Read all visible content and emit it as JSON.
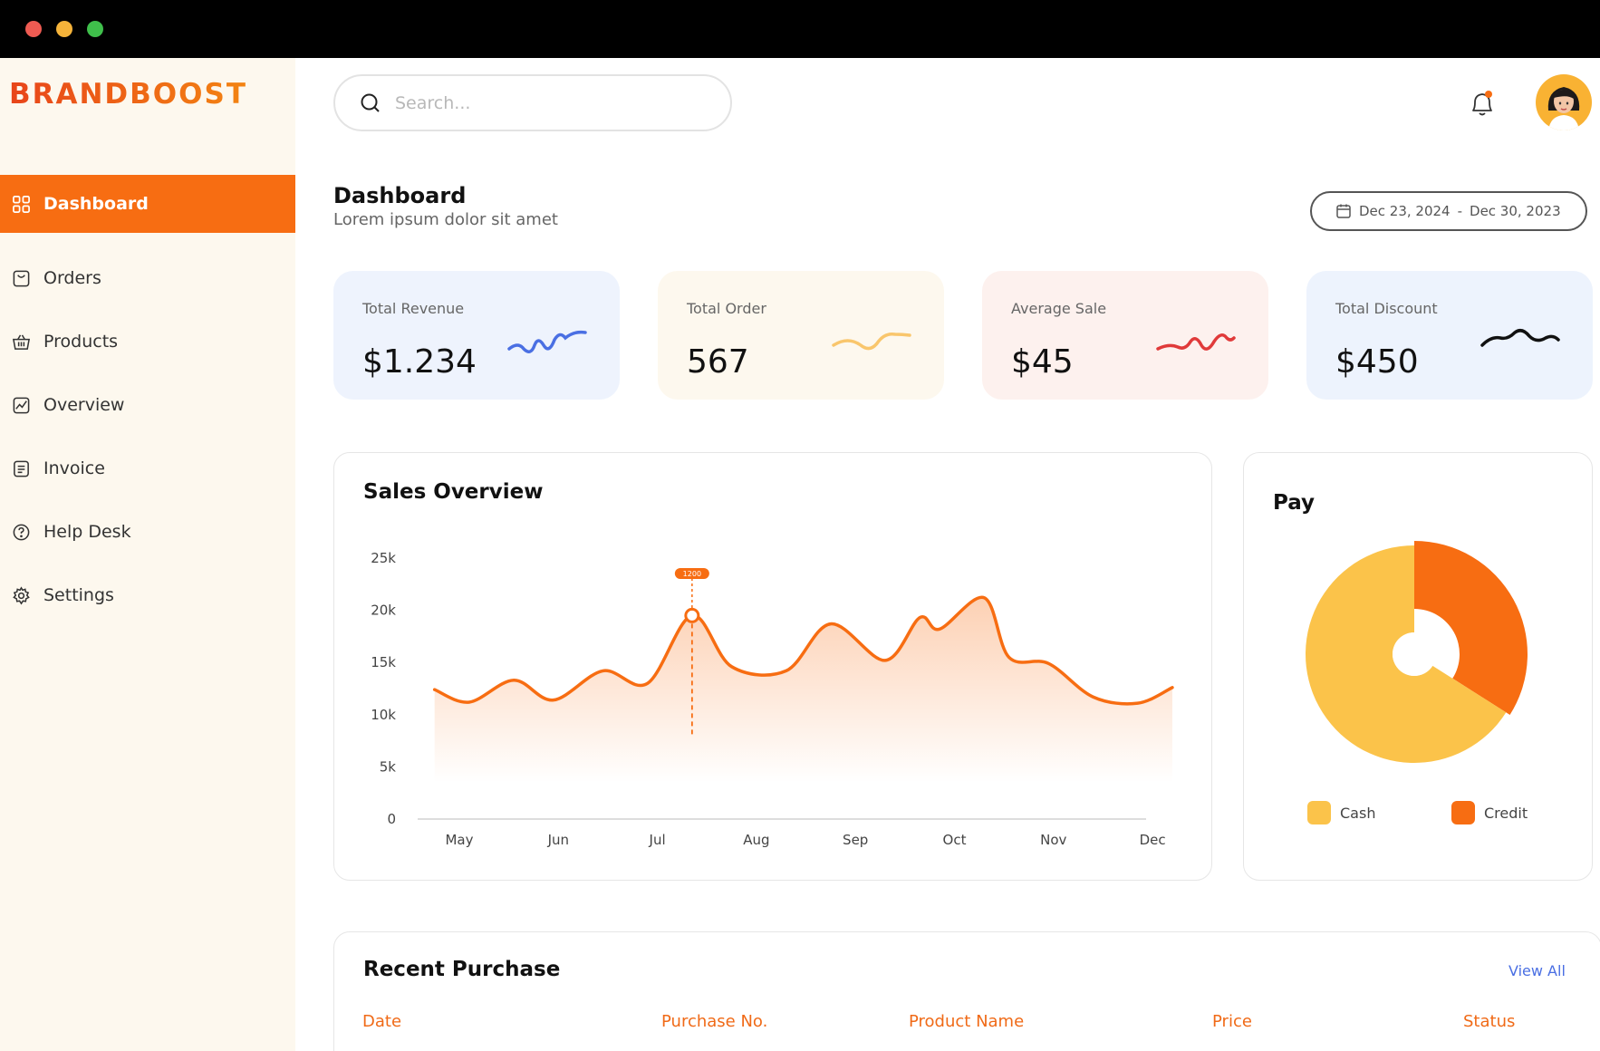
{
  "brand": {
    "name": "BRANDBOOST"
  },
  "sidebar": {
    "items": [
      {
        "label": "Dashboard",
        "icon": "grid-icon",
        "active": true
      },
      {
        "label": "Orders",
        "icon": "orders-icon"
      },
      {
        "label": "Products",
        "icon": "basket-icon"
      },
      {
        "label": "Overview",
        "icon": "chart-icon"
      },
      {
        "label": "Invoice",
        "icon": "invoice-icon"
      },
      {
        "label": "Help Desk",
        "icon": "help-icon"
      },
      {
        "label": "Settings",
        "icon": "gear-icon"
      }
    ]
  },
  "header": {
    "search_placeholder": "Search...",
    "notification_icon": "bell-icon",
    "notification_color": "#f76d12"
  },
  "page": {
    "title": "Dashboard",
    "subtitle": "Lorem ipsum dolor sit amet",
    "date_from": "Dec 23, 2024",
    "date_to": "Dec 30, 2023",
    "date_separator": "-"
  },
  "stats": [
    {
      "label": "Total Revenue",
      "value": "$1.234",
      "bg": "#eef3fd",
      "stroke": "#4a6fe3"
    },
    {
      "label": "Total Order",
      "value": "567",
      "bg": "#fdf8ee",
      "stroke": "#f9c66c"
    },
    {
      "label": "Average Sale",
      "value": "$45",
      "bg": "#fdf1ee",
      "stroke": "#e03a3a"
    },
    {
      "label": "Total Discount",
      "value": "$450",
      "bg": "#edf3fd",
      "stroke": "#111111"
    }
  ],
  "sales_overview": {
    "title": "Sales Overview",
    "tooltip": "1200"
  },
  "pay": {
    "title": "Pay",
    "legend": [
      {
        "label": "Cash",
        "color": "#fbc34a"
      },
      {
        "label": "Credit",
        "color": "#f76d12"
      }
    ]
  },
  "recent_purchase": {
    "title": "Recent Purchase",
    "view_all": "View All",
    "columns": [
      "Date",
      "Purchase No.",
      "Product Name",
      "Price",
      "Status"
    ]
  },
  "chart_data": [
    {
      "type": "area",
      "title": "Sales Overview",
      "categories": [
        "May",
        "Jun",
        "Jul",
        "Aug",
        "Sep",
        "Oct",
        "Nov",
        "Dec"
      ],
      "yticks": [
        "0",
        "5k",
        "10k",
        "15k",
        "20k",
        "25k"
      ],
      "ylim": [
        0,
        25000
      ],
      "series": [
        {
          "color": "#f76d12",
          "x": [
            4.75,
            5.1,
            5.55,
            5.95,
            6.45,
            6.9,
            7.35,
            7.75,
            8.3,
            8.75,
            9.3,
            9.65,
            9.85,
            10.3,
            10.55,
            10.95,
            11.4,
            11.85,
            12.2
          ],
          "values": [
            12400,
            11200,
            13300,
            11400,
            14200,
            13000,
            19500,
            14600,
            14200,
            18700,
            15200,
            19300,
            18200,
            21200,
            15500,
            14900,
            11700,
            11100,
            12600
          ]
        }
      ],
      "highlight": {
        "x": 7.35,
        "value": 19500,
        "label": "1200"
      },
      "grid": false
    },
    {
      "type": "pie",
      "title": "Pay",
      "categories": [
        "Cash",
        "Credit"
      ],
      "values": [
        66,
        34
      ],
      "colors": [
        "#fbc34a",
        "#f76d12"
      ]
    }
  ]
}
